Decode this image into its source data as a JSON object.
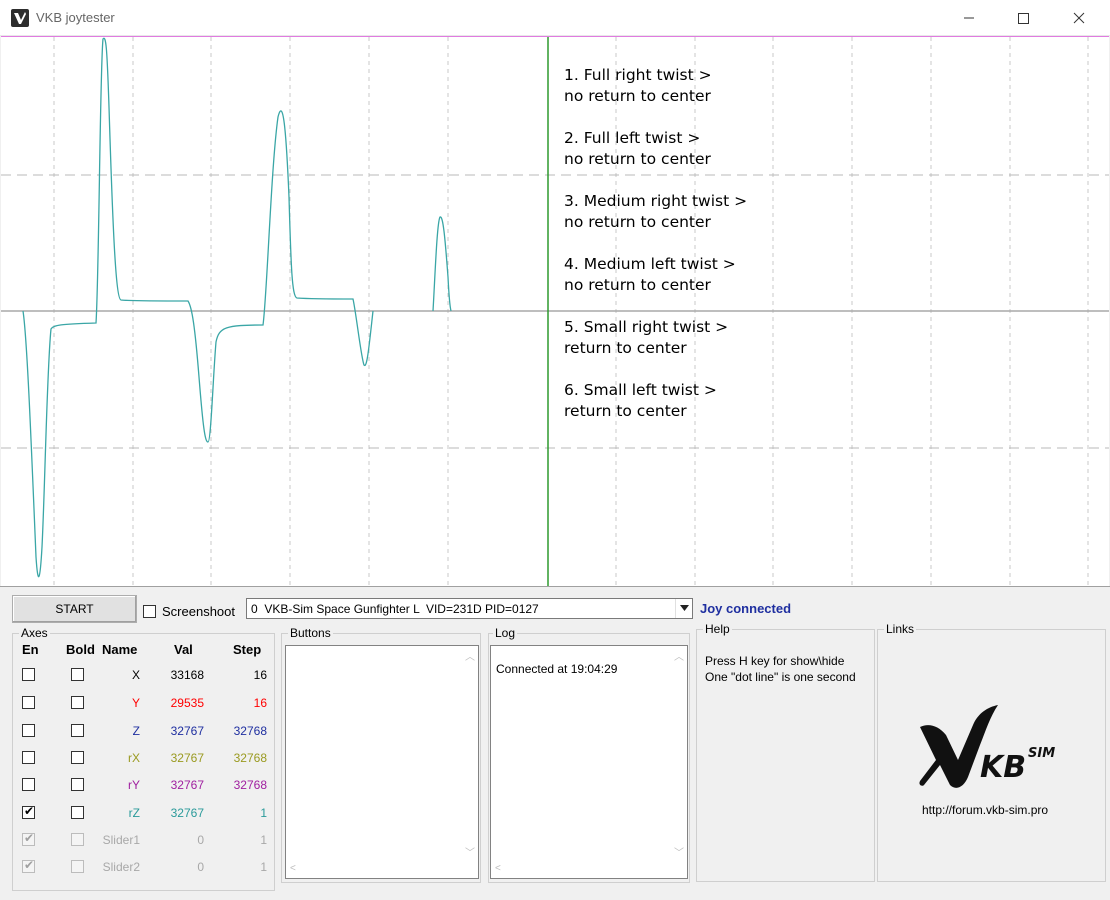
{
  "window": {
    "title": "VKB joytester",
    "minimize_icon": "minimize-icon",
    "maximize_icon": "maximize-icon",
    "close_icon": "close-icon"
  },
  "graph": {
    "trace_color": "#3aa6a6",
    "instructions": [
      "1. Full right twist >\nno return to center",
      "2. Full left twist >\nno return to center",
      "3. Medium right twist >\nno return to center",
      "4. Medium left twist >\nno return to center",
      "5. Small right twist >\nreturn to center",
      "6. Small left twist >\nreturn to center"
    ]
  },
  "controls": {
    "start_label": "START",
    "screenshot_label": "Screenshoot",
    "screenshot_checked": false,
    "device_value": "0  VKB-Sim Space Gunfighter L  VID=231D PID=0127",
    "status": "Joy connected"
  },
  "axes": {
    "group_label": "Axes",
    "headers": {
      "en": "En",
      "bold": "Bold",
      "name": "Name",
      "val": "Val",
      "step": "Step"
    },
    "rows": [
      {
        "name": "X",
        "val": "33168",
        "step": "16",
        "color": "#000000",
        "en": false,
        "bold": false,
        "disabled": false
      },
      {
        "name": "Y",
        "val": "29535",
        "step": "16",
        "color": "#ff0000",
        "en": false,
        "bold": false,
        "disabled": false
      },
      {
        "name": "Z",
        "val": "32767",
        "step": "32768",
        "color": "#1f2fa0",
        "en": false,
        "bold": false,
        "disabled": false
      },
      {
        "name": "rX",
        "val": "32767",
        "step": "32768",
        "color": "#9a9a20",
        "en": false,
        "bold": false,
        "disabled": false
      },
      {
        "name": "rY",
        "val": "32767",
        "step": "32768",
        "color": "#a020a0",
        "en": false,
        "bold": false,
        "disabled": false
      },
      {
        "name": "rZ",
        "val": "32767",
        "step": "1",
        "color": "#2a9a9a",
        "en": true,
        "bold": false,
        "disabled": false
      },
      {
        "name": "Slider1",
        "val": "0",
        "step": "1",
        "color": "#a8a8a8",
        "en": true,
        "bold": false,
        "disabled": true
      },
      {
        "name": "Slider2",
        "val": "0",
        "step": "1",
        "color": "#a8a8a8",
        "en": true,
        "bold": false,
        "disabled": true
      }
    ]
  },
  "buttons": {
    "group_label": "Buttons"
  },
  "log": {
    "group_label": "Log",
    "entries": [
      "Connected at 19:04:29"
    ]
  },
  "help": {
    "group_label": "Help",
    "lines": [
      "Press H key for show\\hide",
      "One \"dot line\" is one second"
    ]
  },
  "links": {
    "group_label": "Links",
    "logo_icon": "vkb-sim-logo",
    "url": "http://forum.vkb-sim.pro"
  }
}
